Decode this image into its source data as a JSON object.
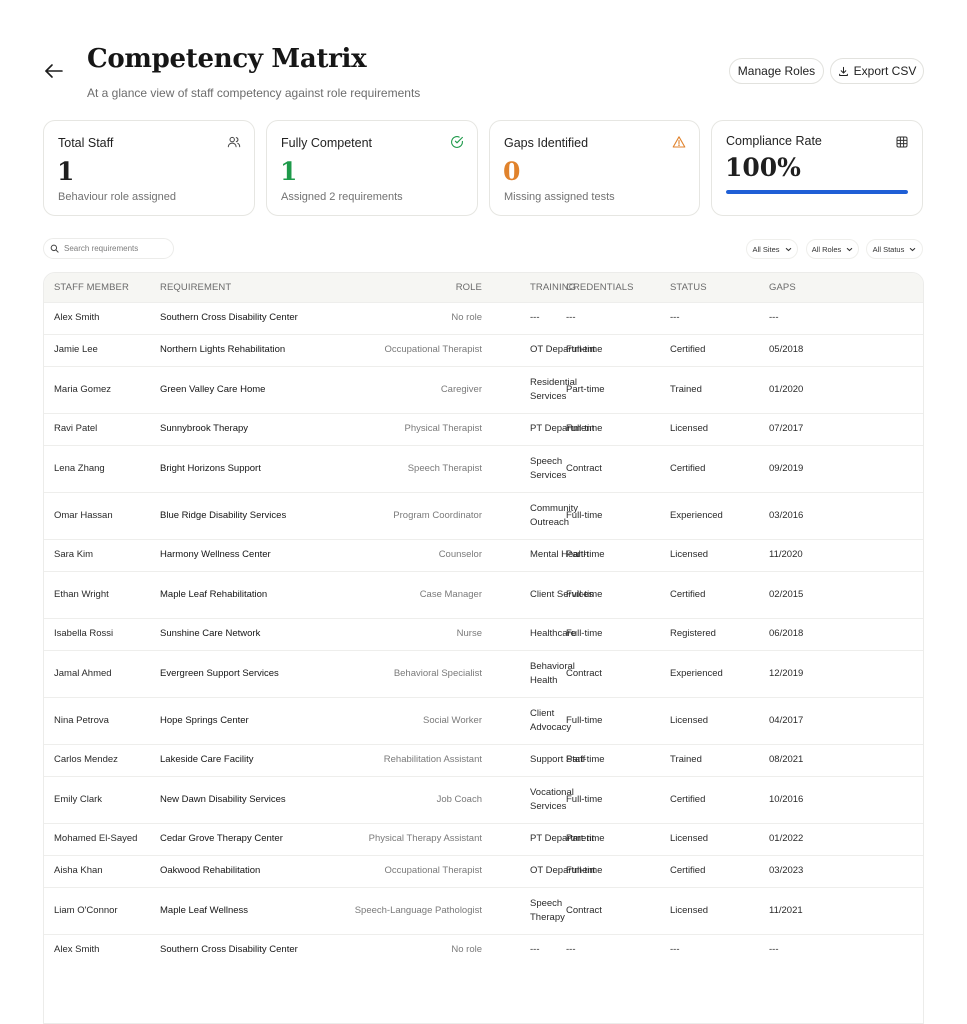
{
  "header": {
    "title": "Competency Matrix",
    "subtitle": "At a glance view of staff competency against role requirements",
    "manage_roles_label": "Manage Roles",
    "export_label": "Export CSV"
  },
  "cards": [
    {
      "title": "Total Staff",
      "value": "1",
      "sub": "Behaviour role assigned",
      "icon": "users-icon",
      "color": "#161616"
    },
    {
      "title": "Fully Competent",
      "value": "1",
      "sub": "Assigned 2 requirements",
      "icon": "check-circle-icon",
      "color": "#1e9a4a"
    },
    {
      "title": "Gaps Identified",
      "value": "0",
      "sub": "Missing assigned tests",
      "icon": "warning-icon",
      "color": "#e0822c"
    },
    {
      "title": "Compliance Rate",
      "value": "100%",
      "progress": 1.0,
      "icon": "grid-icon",
      "color": "#161616",
      "bar_color": "#1f5fd6"
    }
  ],
  "toolbar": {
    "search_placeholder": "Search requirements",
    "filters": [
      "All Sites",
      "All Roles",
      "All Status"
    ]
  },
  "table": {
    "columns": [
      "STAFF MEMBER",
      "REQUIREMENT",
      "ROLE",
      "TRAINING",
      "CREDENTIALS",
      "STATUS",
      "GAPS"
    ],
    "rows": [
      {
        "staff": "Alex Smith",
        "requirement": "Southern Cross Disability Center",
        "role": "No role",
        "training": "---",
        "credentials": "---",
        "status": "---",
        "gaps": "---"
      },
      {
        "staff": "Jamie Lee",
        "requirement": "Northern Lights Rehabilitation",
        "role": "Occupational Therapist",
        "training": "OT Department",
        "credentials": "Full-time",
        "status": "Certified",
        "gaps": "05/2018"
      },
      {
        "staff": "Maria Gomez",
        "requirement": "Green Valley Care Home",
        "role": "Caregiver",
        "training": "Residential Services",
        "credentials": "Part-time",
        "status": "Trained",
        "gaps": "01/2020"
      },
      {
        "staff": "Ravi Patel",
        "requirement": "Sunnybrook Therapy",
        "role": "Physical Therapist",
        "training": "PT Department",
        "credentials": "Full-time",
        "status": "Licensed",
        "gaps": "07/2017"
      },
      {
        "staff": "Lena Zhang",
        "requirement": "Bright Horizons Support",
        "role": "Speech Therapist",
        "training": "Speech Services",
        "credentials": "Contract",
        "status": "Certified",
        "gaps": "09/2019"
      },
      {
        "staff": "Omar Hassan",
        "requirement": "Blue Ridge Disability Services",
        "role": "Program Coordinator",
        "training": "Community Outreach",
        "credentials": "Full-time",
        "status": "Experienced",
        "gaps": "03/2016"
      },
      {
        "staff": "Sara Kim",
        "requirement": "Harmony Wellness Center",
        "role": "Counselor",
        "training": "Mental Health",
        "credentials": "Part-time",
        "status": "Licensed",
        "gaps": "11/2020"
      },
      {
        "staff": "Ethan Wright",
        "requirement": "Maple Leaf Rehabilitation",
        "role": "Case Manager",
        "training": "Client Services",
        "credentials": "Full-time",
        "status": "Certified",
        "gaps": "02/2015"
      },
      {
        "staff": "Isabella Rossi",
        "requirement": "Sunshine Care Network",
        "role": "Nurse",
        "training": "Healthcare",
        "credentials": "Full-time",
        "status": "Registered",
        "gaps": "06/2018"
      },
      {
        "staff": "Jamal Ahmed",
        "requirement": "Evergreen Support Services",
        "role": "Behavioral Specialist",
        "training": "Behavioral Health",
        "credentials": "Contract",
        "status": "Experienced",
        "gaps": "12/2019"
      },
      {
        "staff": "Nina Petrova",
        "requirement": "Hope Springs Center",
        "role": "Social Worker",
        "training": "Client Advocacy",
        "credentials": "Full-time",
        "status": "Licensed",
        "gaps": "04/2017"
      },
      {
        "staff": "Carlos Mendez",
        "requirement": "Lakeside Care Facility",
        "role": "Rehabilitation Assistant",
        "training": "Support Staff",
        "credentials": "Part-time",
        "status": "Trained",
        "gaps": "08/2021"
      },
      {
        "staff": "Emily Clark",
        "requirement": "New Dawn Disability Services",
        "role": "Job Coach",
        "training": "Vocational Services",
        "credentials": "Full-time",
        "status": "Certified",
        "gaps": "10/2016"
      },
      {
        "staff": "Mohamed El-Sayed",
        "requirement": "Cedar Grove Therapy Center",
        "role": "Physical Therapy Assistant",
        "training": "PT Department",
        "credentials": "Part-time",
        "status": "Licensed",
        "gaps": "01/2022"
      },
      {
        "staff": "Aisha Khan",
        "requirement": "Oakwood Rehabilitation",
        "role": "Occupational Therapist",
        "training": "OT Department",
        "credentials": "Full-time",
        "status": "Certified",
        "gaps": "03/2023"
      },
      {
        "staff": "Liam O'Connor",
        "requirement": "Maple Leaf Wellness",
        "role": "Speech-Language Pathologist",
        "training": "Speech Therapy",
        "credentials": "Contract",
        "status": "Licensed",
        "gaps": "11/2021"
      },
      {
        "staff": "Alex Smith",
        "requirement": "Southern Cross Disability Center",
        "role": "No role",
        "training": "---",
        "credentials": "---",
        "status": "---",
        "gaps": "---"
      }
    ]
  }
}
